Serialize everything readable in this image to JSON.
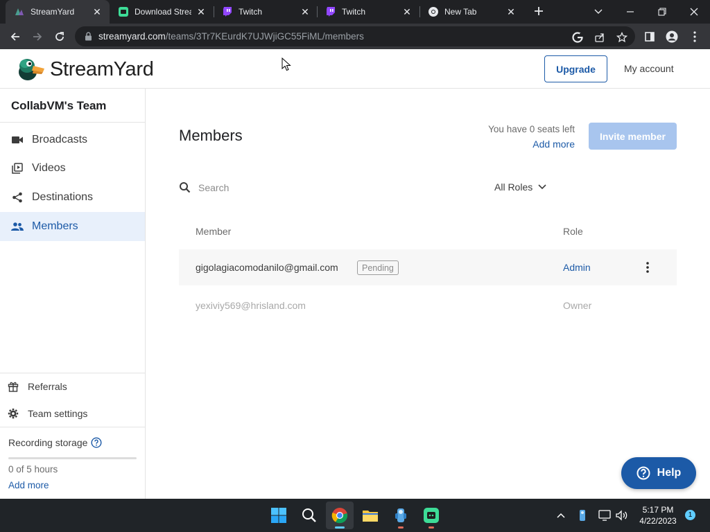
{
  "browser": {
    "tabs": [
      {
        "title": "StreamYard",
        "icon": "streamyard-favicon",
        "active": true
      },
      {
        "title": "Download Strea",
        "icon": "download-app-favicon",
        "active": false
      },
      {
        "title": "Twitch",
        "icon": "twitch-favicon",
        "active": false
      },
      {
        "title": "Twitch",
        "icon": "twitch-favicon",
        "active": false
      },
      {
        "title": "New Tab",
        "icon": "chrome-favicon",
        "active": false
      }
    ],
    "url_host": "streamyard.com",
    "url_path": "/teams/3Tr7KEurdK7UJWjiGC55FiML/members"
  },
  "header": {
    "logo_text": "StreamYard",
    "upgrade_label": "Upgrade",
    "account_label": "My account"
  },
  "sidebar": {
    "team_name": "CollabVM's Team",
    "items": [
      {
        "label": "Broadcasts",
        "icon": "video-camera-icon"
      },
      {
        "label": "Videos",
        "icon": "video-library-icon"
      },
      {
        "label": "Destinations",
        "icon": "share-icon"
      },
      {
        "label": "Members",
        "icon": "people-icon",
        "active": true
      }
    ],
    "footer_items": [
      {
        "label": "Referrals",
        "icon": "gift-icon"
      },
      {
        "label": "Team settings",
        "icon": "gear-icon"
      }
    ],
    "storage": {
      "label": "Recording storage",
      "usage_text": "0 of 5 hours",
      "used_fraction": 0,
      "add_more_label": "Add more"
    }
  },
  "main": {
    "title": "Members",
    "seats_text": "You have 0 seats left",
    "seats_add_label": "Add more",
    "invite_label": "Invite member",
    "search_placeholder": "Search",
    "roles_filter_label": "All Roles",
    "columns": {
      "member": "Member",
      "role": "Role"
    },
    "members": [
      {
        "email": "gigolagiacomodanilo@gmail.com",
        "status": "Pending",
        "role": "Admin"
      },
      {
        "email": "yexiviy569@hrisland.com",
        "role": "Owner"
      }
    ]
  },
  "help_label": "Help",
  "taskbar": {
    "time": "5:17 PM",
    "date": "4/22/2023",
    "notification_count": "1"
  },
  "colors": {
    "brand_blue": "#1c5aa7",
    "invite_disabled": "#a8c5ee",
    "active_nav_bg": "#e8f0fb"
  }
}
